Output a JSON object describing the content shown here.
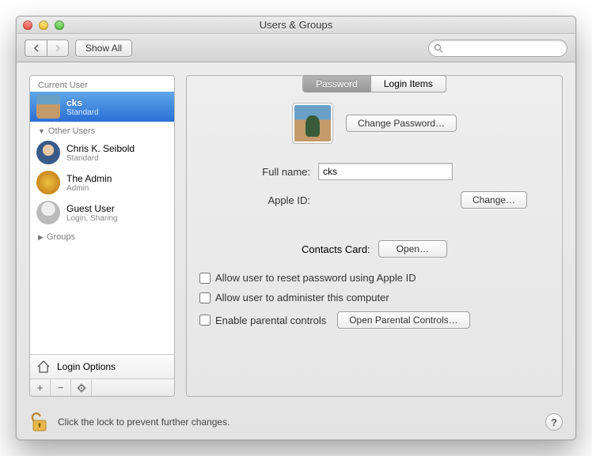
{
  "window": {
    "title": "Users & Groups"
  },
  "toolbar": {
    "show_all": "Show All",
    "search_placeholder": ""
  },
  "sidebar": {
    "current_user_header": "Current User",
    "other_users_header": "Other Users",
    "groups_header": "Groups",
    "login_options": "Login Options",
    "users": [
      {
        "name": "cks",
        "role": "Standard",
        "selected": true
      },
      {
        "name": "Chris K. Seibold",
        "role": "Standard"
      },
      {
        "name": "The Admin",
        "role": "Admin"
      },
      {
        "name": "Guest User",
        "role": "Login, Sharing"
      }
    ]
  },
  "tabs": {
    "password": "Password",
    "login_items": "Login Items"
  },
  "main": {
    "change_password": "Change Password…",
    "full_name_label": "Full name:",
    "full_name_value": "cks",
    "apple_id_label": "Apple ID:",
    "apple_id_change": "Change…",
    "contacts_label": "Contacts Card:",
    "contacts_open": "Open…",
    "allow_reset": "Allow user to reset password using Apple ID",
    "allow_admin": "Allow user to administer this computer",
    "enable_parental": "Enable parental controls",
    "open_parental": "Open Parental Controls…"
  },
  "footer": {
    "lock_text": "Click the lock to prevent further changes."
  }
}
